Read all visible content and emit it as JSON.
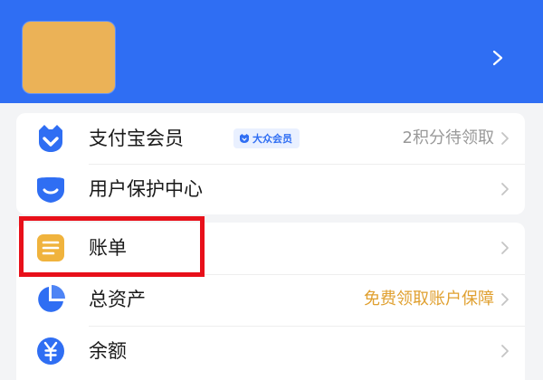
{
  "header": {
    "avatar_alt": "",
    "chevron_icon": "chevron-right-icon"
  },
  "card1": {
    "rows": [
      {
        "label": "支付宝会员",
        "badge": "大众会员",
        "right_text": "2积分待领取",
        "right_color": "#999999",
        "icon": "member-face-icon"
      },
      {
        "label": "用户保护中心",
        "right_text": "",
        "icon": "shield-icon"
      }
    ]
  },
  "card2": {
    "rows": [
      {
        "label": "账单",
        "right_text": "",
        "icon": "bill-icon"
      },
      {
        "label": "总资产",
        "right_text": "免费领取账户保障",
        "right_color": "#e0a030",
        "icon": "pie-chart-icon"
      },
      {
        "label": "余额",
        "right_text": "",
        "icon": "yuan-icon"
      }
    ]
  },
  "colors": {
    "brand_blue": "#2f6ef3",
    "avatar": "#ebb257",
    "highlight_red": "#e8101a",
    "bill_orange": "#f0b33d"
  }
}
